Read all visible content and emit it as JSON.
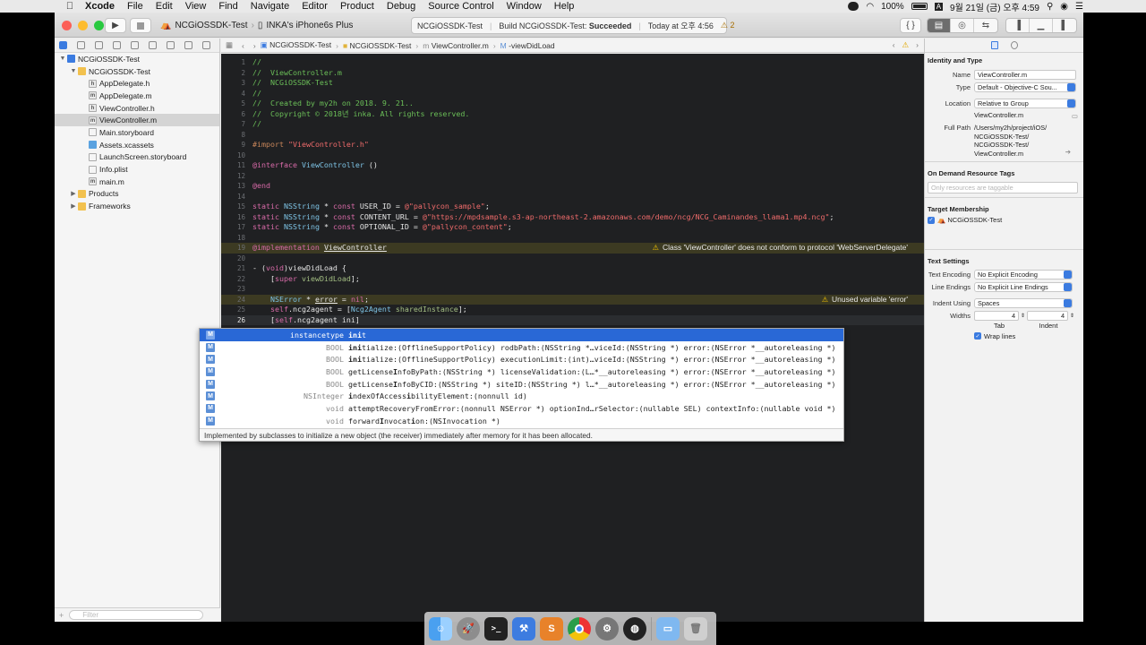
{
  "menubar": {
    "apple": "",
    "items": [
      "Xcode",
      "File",
      "Edit",
      "View",
      "Find",
      "Navigate",
      "Editor",
      "Product",
      "Debug",
      "Source Control",
      "Window",
      "Help"
    ],
    "battery": "100%",
    "input_source": "A",
    "clock": "9월 21일 (금) 오후 4:59"
  },
  "toolbar": {
    "scheme": "NCGiOSSDK-Test",
    "destination": "INKA's iPhone6s Plus",
    "activity_project": "NCGiOSSDK-Test",
    "activity_build": "Build NCGiOSSDK-Test:",
    "activity_status": "Succeeded",
    "activity_time": "Today at 오후 4:56",
    "warning_count": "2",
    "code_review_icon": "{ }"
  },
  "navigator": {
    "items": [
      {
        "label": "NCGiOSSDK-Test",
        "icon": "proj",
        "depth": 0,
        "disclosure": "▼"
      },
      {
        "label": "NCGiOSSDK-Test",
        "icon": "folder",
        "depth": 1,
        "disclosure": "▼"
      },
      {
        "label": "AppDelegate.h",
        "icon": "h",
        "depth": 2,
        "disclosure": ""
      },
      {
        "label": "AppDelegate.m",
        "icon": "m",
        "depth": 2,
        "disclosure": ""
      },
      {
        "label": "ViewController.h",
        "icon": "h",
        "depth": 2,
        "disclosure": ""
      },
      {
        "label": "ViewController.m",
        "icon": "m",
        "depth": 2,
        "disclosure": "",
        "selected": true
      },
      {
        "label": "Main.storyboard",
        "icon": "sb",
        "depth": 2,
        "disclosure": ""
      },
      {
        "label": "Assets.xcassets",
        "icon": "xc",
        "depth": 2,
        "disclosure": ""
      },
      {
        "label": "LaunchScreen.storyboard",
        "icon": "sb",
        "depth": 2,
        "disclosure": ""
      },
      {
        "label": "Info.plist",
        "icon": "pl",
        "depth": 2,
        "disclosure": ""
      },
      {
        "label": "main.m",
        "icon": "m",
        "depth": 2,
        "disclosure": ""
      },
      {
        "label": "Products",
        "icon": "folder",
        "depth": 1,
        "disclosure": "▶"
      },
      {
        "label": "Frameworks",
        "icon": "folder",
        "depth": 1,
        "disclosure": "▶"
      }
    ],
    "filter_placeholder": "Filter"
  },
  "jumpbar": {
    "crumbs": [
      "NCGiOSSDK-Test",
      "NCGiOSSDK-Test",
      "ViewController.m",
      "-viewDidLoad"
    ]
  },
  "editor": {
    "lines": [
      {
        "n": "1",
        "html": "<span class='cmt'>//</span>"
      },
      {
        "n": "2",
        "html": "<span class='cmt'>//  ViewController.m</span>"
      },
      {
        "n": "3",
        "html": "<span class='cmt'>//  NCGiOSSDK-Test</span>"
      },
      {
        "n": "4",
        "html": "<span class='cmt'>//</span>"
      },
      {
        "n": "5",
        "html": "<span class='cmt'>//  Created by my2h on 2018. 9. 21..</span>"
      },
      {
        "n": "6",
        "html": "<span class='cmt'>//  Copyright © 2018년 inka. All rights reserved.</span>"
      },
      {
        "n": "7",
        "html": "<span class='cmt'>//</span>"
      },
      {
        "n": "8",
        "html": ""
      },
      {
        "n": "9",
        "html": "<span class='pp'>#import </span><span class='str'>\"ViewController.h\"</span>"
      },
      {
        "n": "10",
        "html": ""
      },
      {
        "n": "11",
        "html": "<span class='kw'>@interface</span> <span class='ty'>ViewController</span> ()"
      },
      {
        "n": "12",
        "html": ""
      },
      {
        "n": "13",
        "html": "<span class='kw'>@end</span>"
      },
      {
        "n": "14",
        "html": ""
      },
      {
        "n": "15",
        "html": "<span class='kw'>static</span> <span class='ty'>NSString</span> * <span class='kw'>const</span> USER_ID = <span class='str'>@\"pallycon_sample\"</span>;"
      },
      {
        "n": "16",
        "html": "<span class='kw'>static</span> <span class='ty'>NSString</span> * <span class='kw'>const</span> CONTENT_URL = <span class='str'>@\"https://mpdsample.s3-ap-northeast-2.amazonaws.com/demo/ncg/NCG_Caminandes_llama1.mp4.ncg\"</span>;"
      },
      {
        "n": "17",
        "html": "<span class='kw'>static</span> <span class='ty'>NSString</span> * <span class='kw'>const</span> OPTIONAL_ID = <span class='str'>@\"pallycon_content\"</span>;"
      },
      {
        "n": "18",
        "html": ""
      },
      {
        "n": "19",
        "html": "<span class='kw'>@implementation</span> <u>ViewController</u>",
        "issue": true,
        "msg": "Class 'ViewController' does not conform to protocol 'WebServerDelegate'"
      },
      {
        "n": "20",
        "html": ""
      },
      {
        "n": "21",
        "html": "- (<span class='kw'>void</span>)viewDidLoad {"
      },
      {
        "n": "22",
        "html": "    [<span class='kw'>super</span> <span class='mth'>viewDidLoad</span>];"
      },
      {
        "n": "23",
        "html": ""
      },
      {
        "n": "24",
        "html": "    <span class='ty'>NSError</span> * <u>error</u> = <span class='kw'>nil</span>;",
        "issue": true,
        "msg": "Unused variable 'error'"
      },
      {
        "n": "25",
        "html": "    <span class='kw'>self</span>.ncg2agent = [<span class='ty'>Ncg2Agent</span> <span class='mth'>sharedInstance</span>];"
      },
      {
        "n": "26",
        "html": "    [<span class='kw'>self</span>.ncg2agent ini]",
        "current": true
      }
    ]
  },
  "completion": {
    "rows": [
      {
        "type": "instancetype",
        "sig": "<b>ini</b>t",
        "selected": true
      },
      {
        "type": "BOOL",
        "sig": "<b>ini</b>tialize:(OfflineSupportPolicy) rodbPath:(NSString *…viceId:(NSString *) error:(NSError *__autoreleasing *)"
      },
      {
        "type": "BOOL",
        "sig": "<b>ini</b>tialize:(OfflineSupportPolicy) executionLimit:(int)…viceId:(NSString *) error:(NSError *__autoreleasing *)"
      },
      {
        "type": "BOOL",
        "sig": "getLicense<b>I</b>nfoByPath:(NSString *) licenseValidation:(L…*__autoreleasing *) error:(NSError *__autoreleasing *)"
      },
      {
        "type": "BOOL",
        "sig": "getLicense<b>I</b>nfoByCID:(NSString *) siteID:(NSString *) l…*__autoreleasing *) error:(NSError *__autoreleasing *)"
      },
      {
        "type": "NSInteger",
        "sig": "<b>i</b>ndexOfAccess<b>i</b>bilityElement:(nonnull id)"
      },
      {
        "type": "void",
        "sig": "attemptRecoveryFromError:(nonnull NSError *) optionInd…rSelector:(nullable SEL) contextInfo:(nullable void *)"
      },
      {
        "type": "void",
        "sig": "forward<b>I</b>nvocat<b>i</b>on:(NSInvocation *)"
      }
    ],
    "description": "Implemented by subclasses to initialize a new object (the receiver) immediately after memory for it has been allocated."
  },
  "inspector": {
    "identity_title": "Identity and Type",
    "name_label": "Name",
    "name_value": "ViewController.m",
    "type_label": "Type",
    "type_value": "Default - Objective-C Sou...",
    "location_label": "Location",
    "location_value": "Relative to Group",
    "location_file": "ViewController.m",
    "fullpath_label": "Full Path",
    "fullpath_value": "/Users/my2h/project/iOS/ NCGiOSSDK-Test/ NCGiOSSDK-Test/ ViewController.m",
    "odr_title": "On Demand Resource Tags",
    "odr_placeholder": "Only resources are taggable",
    "target_title": "Target Membership",
    "target_item": "NCGiOSSDK-Test",
    "text_title": "Text Settings",
    "encoding_label": "Text Encoding",
    "encoding_value": "No Explicit Encoding",
    "endings_label": "Line Endings",
    "endings_value": "No Explicit Line Endings",
    "indent_label": "Indent Using",
    "indent_value": "Spaces",
    "widths_label": "Widths",
    "tab_value": "4",
    "indent_value_num": "4",
    "tab_caption": "Tab",
    "indent_caption": "Indent",
    "wrap_label": "Wrap lines"
  },
  "dock": {
    "apps": [
      "finder",
      "launchpad",
      "terminal",
      "xcode",
      "sublime",
      "chrome",
      "system-preferences",
      "obs",
      "folder",
      "trash"
    ]
  },
  "colors": {
    "editor_bg": "#1f2022",
    "selection_blue": "#2968d6",
    "warning_yellow": "#f5c400"
  }
}
